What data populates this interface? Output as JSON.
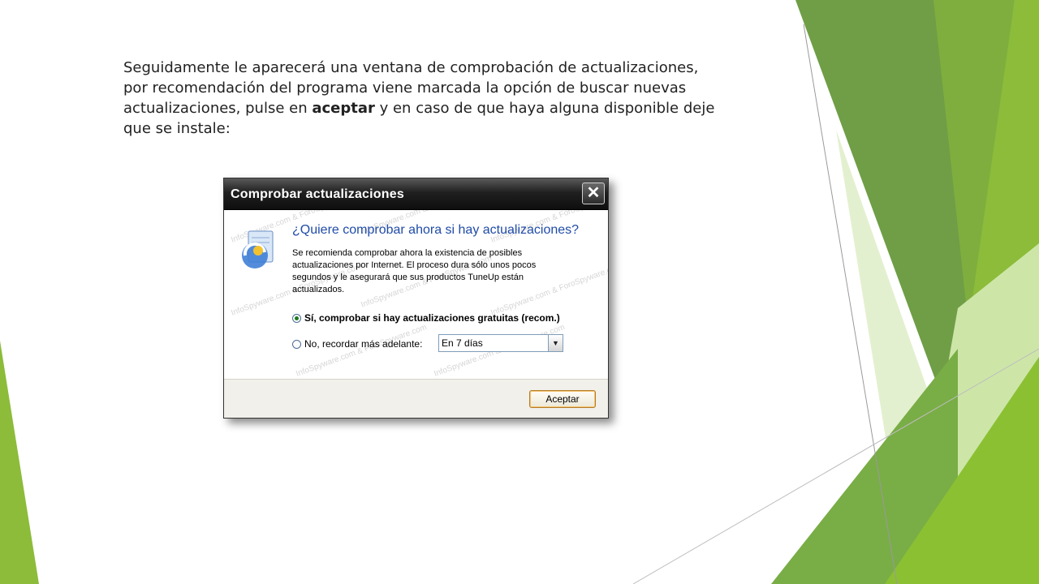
{
  "slide": {
    "paragraph_before": "Seguidamente le aparecerá una ventana de comprobación de actualizaciones, por recomendación del programa viene marcada la opción de buscar nuevas actualizaciones, pulse en ",
    "paragraph_bold": "aceptar",
    "paragraph_after": " y en caso de que haya alguna disponible deje que se instale:"
  },
  "dialog": {
    "title": "Comprobar actualizaciones",
    "close_symbol": "✕",
    "question": "¿Quiere comprobar ahora si hay actualizaciones?",
    "description": "Se recomienda comprobar ahora la existencia de posibles actualizaciones por Internet. El proceso dura sólo unos pocos segundos y le asegurará que sus productos TuneUp están actualizados.",
    "option_yes": "Sí, comprobar si hay actualizaciones gratuitas (recom.)",
    "option_later": "No, recordar más adelante:",
    "select_value": "En 7 días",
    "accept_label": "Aceptar",
    "selected_option": "yes",
    "watermark_text": "InfoSpyware.com & ForoSpyware.com"
  },
  "colors": {
    "green_dark": "#6b9a3e",
    "green_mid": "#8cbc3a",
    "green_light": "#cde6a8",
    "question_blue": "#1f4ba8"
  },
  "icons": {
    "close": "close-icon",
    "app": "tuneup-update-icon",
    "dropdown": "chevron-down-icon"
  }
}
